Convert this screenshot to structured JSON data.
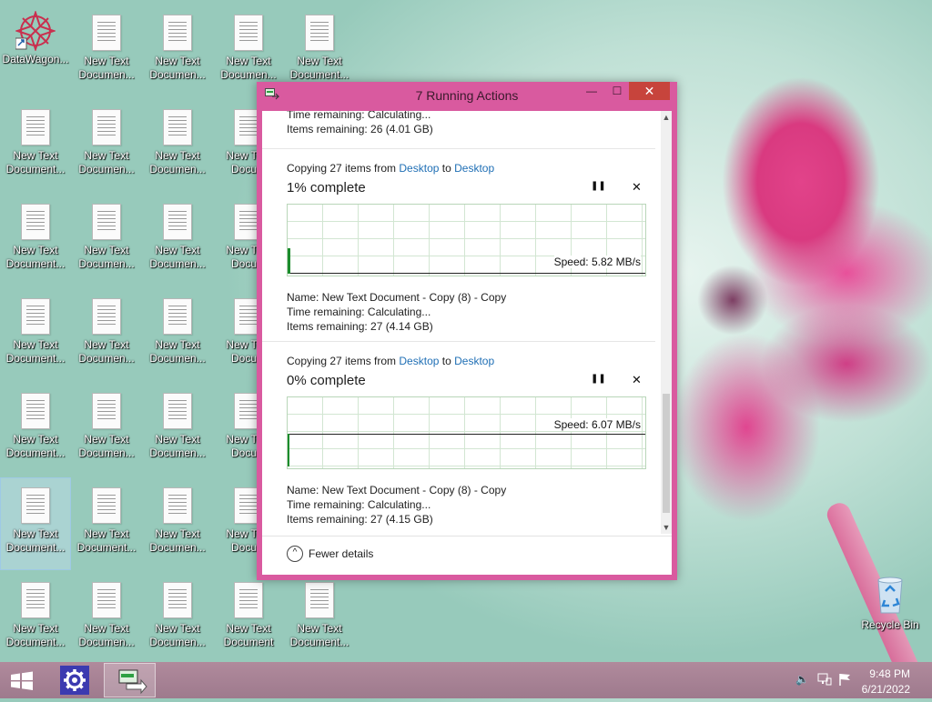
{
  "desktop": {
    "icons": [
      {
        "label": "DataWagon...",
        "type": "shortcut"
      },
      {
        "label": "New Text Documen..."
      },
      {
        "label": "New Text Documen..."
      },
      {
        "label": "New Text Documen..."
      },
      {
        "label": "New Text Document..."
      },
      {
        "label": "New Text Document..."
      },
      {
        "label": "New Text Documen..."
      },
      {
        "label": "New Text Documen..."
      },
      {
        "label": "New Text Docum"
      },
      {
        "label": "New Text Document..."
      },
      {
        "label": "New Text Documen..."
      },
      {
        "label": "New Text Documen..."
      },
      {
        "label": "New Text Docum"
      },
      {
        "label": "New Text Document..."
      },
      {
        "label": "New Text Documen..."
      },
      {
        "label": "New Text Documen..."
      },
      {
        "label": "New Text Docum"
      },
      {
        "label": "New Text Document..."
      },
      {
        "label": "New Text Documen..."
      },
      {
        "label": "New Text Documen..."
      },
      {
        "label": "New Text Docum"
      },
      {
        "label": "New Text Document..."
      },
      {
        "label": "New Text Document..."
      },
      {
        "label": "New Text Documen..."
      },
      {
        "label": "New Text Docum"
      },
      {
        "label": "New Text Document..."
      },
      {
        "label": "New Text Documen..."
      },
      {
        "label": "New Text Documen..."
      },
      {
        "label": "New Text Document"
      },
      {
        "label": "New Text Document..."
      }
    ],
    "recycle_bin": "Recycle Bin"
  },
  "window": {
    "title": "7 Running Actions",
    "minimize": "—",
    "maximize": "☐",
    "close": "✕",
    "top_partial": {
      "time_remaining": "Time remaining:  Calculating...",
      "items_remaining": "Items remaining:  26 (4.01 GB)"
    },
    "operations": [
      {
        "prefix": "Copying 27 items from ",
        "from": "Desktop",
        "mid": " to ",
        "to": "Desktop",
        "percent": 1,
        "percent_label": "1% complete",
        "speed": "Speed: 5.82 MB/s",
        "name": "Name:  New Text Document - Copy (8) - Copy",
        "time_remaining": "Time remaining:  Calculating...",
        "items_remaining": "Items remaining:  27 (4.14 GB)",
        "pause": "❚❚",
        "cancel": "✕"
      },
      {
        "prefix": "Copying 27 items from ",
        "from": "Desktop",
        "mid": " to ",
        "to": "Desktop",
        "percent": 0,
        "percent_label": "0% complete",
        "speed": "Speed: 6.07 MB/s",
        "name": "Name:  New Text Document - Copy (8) - Copy",
        "time_remaining": "Time remaining:  Calculating...",
        "items_remaining": "Items remaining:  27 (4.15 GB)",
        "pause": "❚❚",
        "cancel": "✕"
      }
    ],
    "fewer_details": "Fewer details"
  },
  "taskbar": {
    "time": "9:48 PM",
    "date": "6/21/2022"
  },
  "colors": {
    "window_frame": "#d95a9f",
    "close_button": "#c7443c",
    "link": "#1f6fb5",
    "graph_fill": "#1c8c2c"
  }
}
